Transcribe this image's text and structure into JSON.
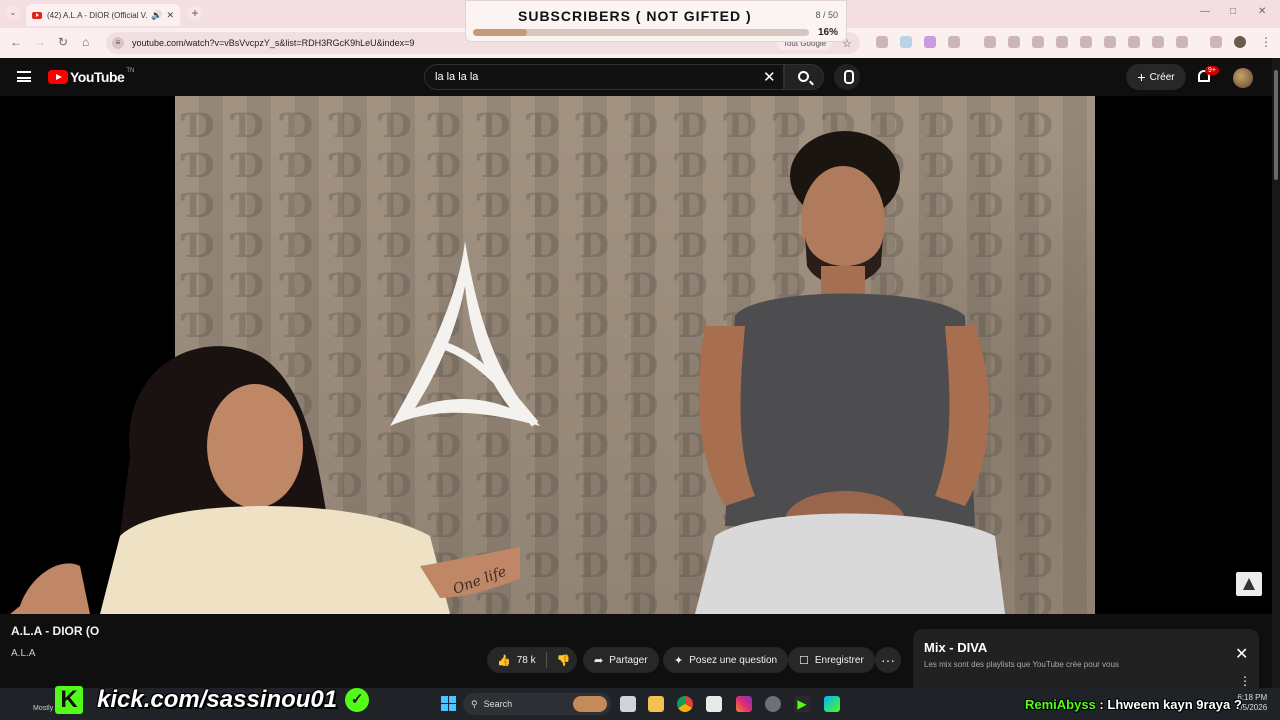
{
  "browser": {
    "tab_title": "(42) A.L.A - DIOR (Official V...",
    "url": "youtube.com/watch?v=vBsVvcpzY_s&list=RDH3RGcK9hLeU&index=9",
    "omnibox_chip": "Tout Google"
  },
  "subscribers_widget": {
    "title": "SUBSCRIBERS ( NOT GIFTED )",
    "count": "8 / 50",
    "percent": "16%",
    "progress": 0.16
  },
  "youtube": {
    "logo_text": "YouTube",
    "logo_tm": "TN",
    "search_query": "la la la la",
    "create_label": "Créer",
    "notifications_badge": "9+"
  },
  "video": {
    "title_visible": "A.L.A - DIOR (O",
    "channel_visible": "A.L.A",
    "likes": "78 k",
    "share_label": "Partager",
    "ask_label": "Posez une question",
    "save_label": "Enregistrer",
    "more_label": "···"
  },
  "mix_panel": {
    "title": "Mix - DIVA",
    "subtitle": "Les mix sont des playlists que YouTube crée pour vous"
  },
  "taskbar": {
    "search_placeholder": "Search",
    "time": "6:18 PM",
    "date": "2/5/2026",
    "weather_label": "Mostly"
  },
  "stream_overlay": {
    "kick_url": "kick.com/sassinou01",
    "chat_user": "RemiAbyss",
    "chat_separator": " : ",
    "chat_message": "Lhweem kayn 9raya ?"
  },
  "video_overlay": {
    "tattoo_text": "One life"
  },
  "colors": {
    "youtube_red": "#ff0000",
    "kick_green": "#53fc18",
    "notification_red": "#cc0000",
    "progress_fill": "#c49a78"
  }
}
